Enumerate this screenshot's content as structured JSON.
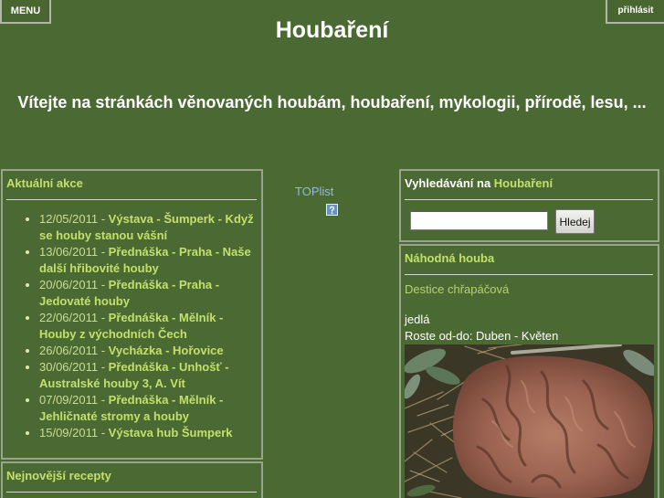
{
  "header": {
    "menu_label": "MENU",
    "login_label": "přihlásit",
    "site_title": "Houbaření",
    "welcome": "Vítejte na stránkách věnovaných houbám, houbaření, mykologii, přírodě, lesu, ..."
  },
  "events": {
    "title": "Aktuální akce",
    "separator": " - ",
    "items": [
      {
        "date": "12/05/2011",
        "title": "Výstava - Šumperk - Když se houby stanou vášní"
      },
      {
        "date": "13/06/2011",
        "title": "Přednáška - Praha - Naše další hřibovité houby"
      },
      {
        "date": "20/06/2011",
        "title": "Přednáška - Praha - Jedovaté houby"
      },
      {
        "date": "22/06/2011",
        "title": "Přednáška - Mělník - Houby z východních Čech"
      },
      {
        "date": "26/06/2011",
        "title": "Vycházka - Hořovice"
      },
      {
        "date": "30/06/2011",
        "title": "Přednáška - Unhošť - Australské houby 3, A. Vít"
      },
      {
        "date": "07/09/2011",
        "title": "Přednáška - Mělník - Jehličnaté stromy a houby"
      },
      {
        "date": "15/09/2011",
        "title": "Výstava hub Šumperk"
      }
    ]
  },
  "recipes": {
    "title": "Nejnovější recepty"
  },
  "toplist": {
    "label": "TOPlist"
  },
  "search": {
    "title_prefix": "Vyhledávání na",
    "title_site": "Houbaření",
    "query": "",
    "button_label": "Hledej"
  },
  "random_mushroom": {
    "title": "Náhodná houba",
    "name": "Destice chřapáčová",
    "edibility": "jedlá",
    "season": "Roste od-do: Duben - Květen"
  },
  "colors": {
    "background": "#4b6a33",
    "accent": "#c2e06b",
    "date": "#c9dc94",
    "muted_link": "#b3d370",
    "toplist": "#97b9d6",
    "panel_border": "#9aa48c"
  },
  "icons": {
    "event_bullet": "bullet-dot-icon",
    "toplist_badge": "broken-image-icon"
  }
}
